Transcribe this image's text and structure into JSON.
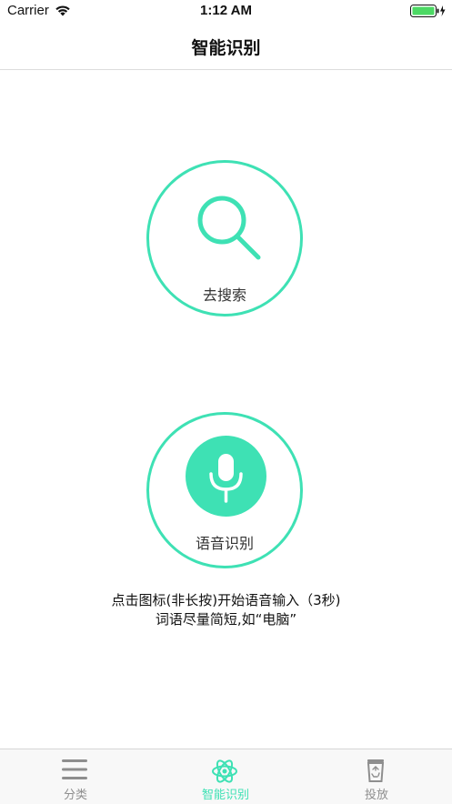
{
  "status_bar": {
    "carrier": "Carrier",
    "time": "1:12 AM"
  },
  "nav": {
    "title": "智能识别"
  },
  "search": {
    "label": "去搜索"
  },
  "voice": {
    "label": "语音识别"
  },
  "hint": {
    "line1": "点击图标(非长按)开始语音输入（3秒)",
    "line2": "词语尽量简短,如“电脑”"
  },
  "tabs": [
    {
      "label": "分类",
      "icon": "list-icon"
    },
    {
      "label": "智能识别",
      "icon": "atom-icon"
    },
    {
      "label": "投放",
      "icon": "trash-bin-icon"
    }
  ],
  "colors": {
    "accent": "#3ee1b4",
    "tab_inactive": "#8e8e8e",
    "battery": "#4cd964"
  }
}
